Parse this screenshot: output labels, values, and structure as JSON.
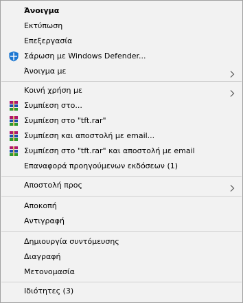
{
  "menu": {
    "open": "Άνοιγμα",
    "print": "Εκτύπωση",
    "edit": "Επεξεργασία",
    "scan_defender": "Σάρωση με Windows Defender...",
    "open_with": "Άνοιγμα με",
    "share_with": "Κοινή χρήση με",
    "compress_to": "Συμπίεση στο...",
    "compress_rar": "Συμπίεση στο \"tft.rar\"",
    "compress_email": "Συμπίεση και αποστολή με email...",
    "compress_rar_email": "Συμπίεση στο \"tft.rar\" και αποστολή με email",
    "restore_versions": "Επαναφορά προηγούμενων εκδόσεων (1)",
    "send_to": "Αποστολή προς",
    "cut": "Αποκοπή",
    "copy": "Αντιγραφή",
    "create_shortcut": "Δημιουργία συντόμευσης",
    "delete": "Διαγραφή",
    "rename": "Μετονομασία",
    "properties": "Ιδιότητες (3)"
  },
  "icons": {
    "defender": "windows-defender-shield-icon",
    "winrar": "winrar-books-icon",
    "submenu": "chevron-right-icon"
  },
  "colors": {
    "menu_background": "#f2f2f2",
    "separator": "#cfcfcf",
    "border": "#a0a0a0",
    "defender_blue": "#1e78d2"
  }
}
